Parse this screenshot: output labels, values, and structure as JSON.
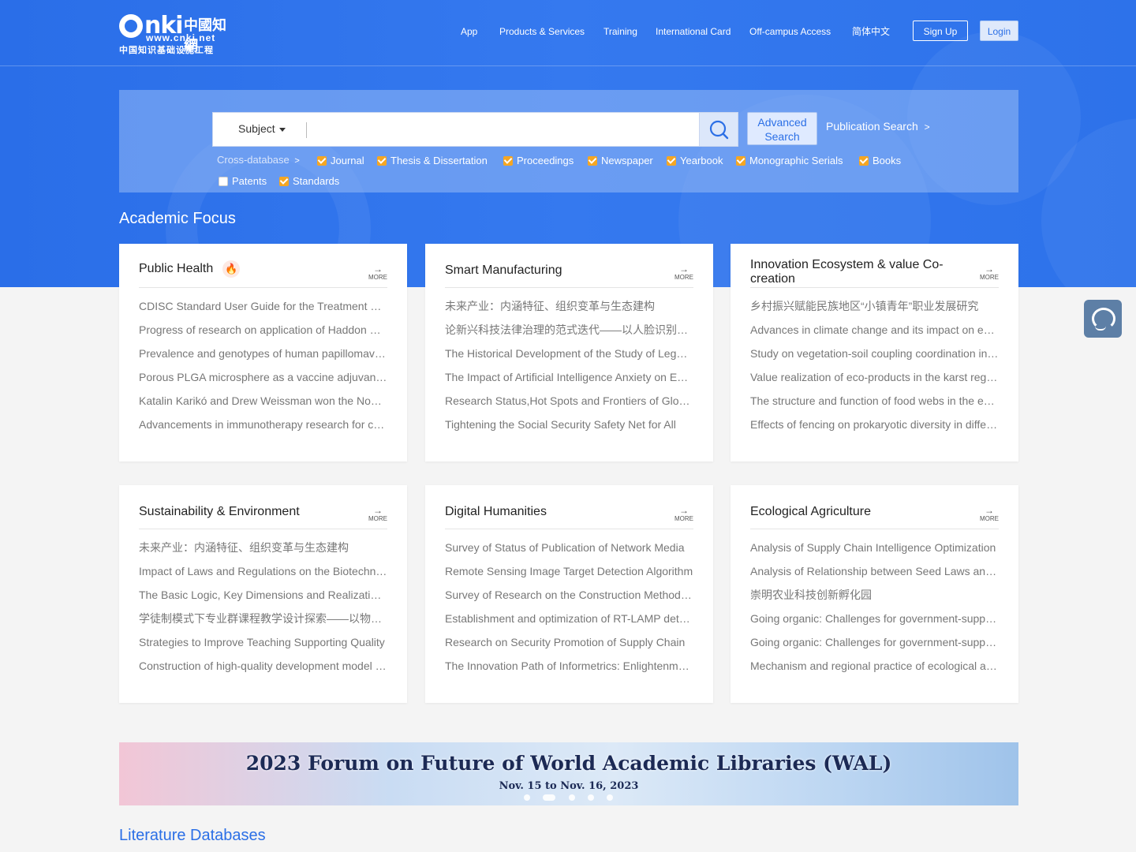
{
  "logo": {
    "mark": "nki",
    "cn_name": "中國知網",
    "url": "www.cnki.net",
    "cn_slogan": "中国知识基础设施工程"
  },
  "nav": {
    "items": [
      "App",
      "Products & Services",
      "Training",
      "International Card",
      "Off-campus Access",
      "简体中文"
    ],
    "signup": "Sign Up",
    "login": "Login"
  },
  "search": {
    "field_label": "Subject",
    "query": "",
    "advanced_line1": "Advanced",
    "advanced_line2": "Search",
    "publication_search": "Publication Search",
    "cross_database": "Cross-database",
    "databases": [
      {
        "label": "Journal",
        "checked": true
      },
      {
        "label": "Thesis & Dissertation",
        "checked": true
      },
      {
        "label": "Proceedings",
        "checked": true
      },
      {
        "label": "Newspaper",
        "checked": true
      },
      {
        "label": "Yearbook",
        "checked": true
      },
      {
        "label": "Monographic Serials",
        "checked": true
      },
      {
        "label": "Books",
        "checked": true
      },
      {
        "label": "Patents",
        "checked": false
      },
      {
        "label": "Standards",
        "checked": true
      }
    ]
  },
  "academic_focus": {
    "title": "Academic Focus",
    "more_label": "MORE",
    "cards": [
      {
        "title": "Public Health",
        "hot": true,
        "items": [
          "CDISC Standard User Guide for the Treatment of Herpes Zoster with Traditional Chinese Medicine",
          "Progress of research on application of Haddon matrix in injury prevention",
          "Prevalence and genotypes of human papillomavirus infection among women",
          "Porous PLGA microsphere as a vaccine adjuvant delivery system",
          "Katalin Karikó and Drew Weissman won the Nobel Prize in Physiology or Medicine",
          "Advancements in immunotherapy research for cancer treatment"
        ]
      },
      {
        "title": "Smart Manufacturing",
        "hot": false,
        "items": [
          "未来产业：内涵特征、组织变革与生态建构",
          "论新兴科技法律治理的范式迭代——以人脸识别技术为例",
          "The Historical Development of the Study of Legal Informatics",
          "The Impact of Artificial Intelligence Anxiety on Employees",
          "Research Status,Hot Spots and Frontiers of Global Smart Manufacturing",
          "Tightening the Social Security Safety Net for All"
        ]
      },
      {
        "title": "Innovation Ecosystem & value Co-creation",
        "hot": false,
        "items": [
          "乡村振兴赋能民族地区“小镇青年”职业发展研究",
          "Advances in climate change and its impact on ecosystems",
          "Study on vegetation-soil coupling coordination in karst areas",
          "Value realization of eco-products in the karst region",
          "The structure and function of food webs in the ecosystem",
          "Effects of fencing on prokaryotic diversity in different grasslands"
        ]
      },
      {
        "title": "Sustainability & Environment",
        "hot": false,
        "items": [
          "未来产业：内涵特征、组织变革与生态建构",
          "Impact of Laws and Regulations on the Biotechnology Industry",
          "The Basic Logic, Key Dimensions and Realization Path",
          "学徒制模式下专业群课程教学设计探索——以物流管理专业为例",
          "Strategies to Improve Teaching Supporting Quality",
          "Construction of high-quality development model for higher education"
        ]
      },
      {
        "title": "Digital Humanities",
        "hot": false,
        "items": [
          "Survey of Status of Publication of Network Media",
          "Remote Sensing Image Target Detection Algorithm",
          "Survey of Research on the Construction Method of Knowledge Graph",
          "Establishment and optimization of RT-LAMP detection method",
          "Research on Security Promotion of Supply Chain",
          "The Innovation Path of Informetrics: Enlightenment and Reflection"
        ]
      },
      {
        "title": "Ecological Agriculture",
        "hot": false,
        "items": [
          "Analysis of Supply Chain Intelligence Optimization",
          "Analysis of Relationship between Seed Laws and Agriculture",
          "崇明农业科技创新孵化园",
          "Going organic: Challenges for government-supported farming",
          "Going organic: Challenges for government-supported farming",
          "Mechanism and regional practice of ecological agriculture"
        ]
      }
    ]
  },
  "banner": {
    "title": "2023 Forum on Future of World Academic Libraries (WAL)",
    "subtitle": "Nov. 15 to Nov. 16, 2023",
    "slide_count": 5,
    "active_slide": 2
  },
  "literature_databases": {
    "title": "Literature Databases"
  },
  "colors": {
    "brand_blue": "#2b6fe6",
    "checkbox_orange": "#f5a623",
    "hot_red": "#ef4b23"
  }
}
